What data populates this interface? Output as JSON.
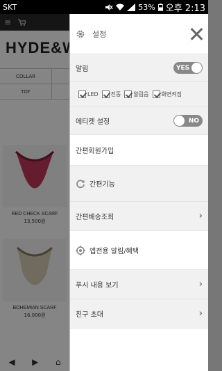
{
  "status_bar": {
    "carrier": "SKT",
    "battery": "53%",
    "time": "오후 2:13"
  },
  "background": {
    "logo": "HYDE&W",
    "categories": [
      [
        "COLLAR",
        ""
      ],
      [
        "TOY",
        ""
      ]
    ],
    "products": [
      {
        "name": "RED CHECK SCARF",
        "price": "13,500원"
      },
      {
        "name": "BOHEMIAN SCARF",
        "price": "16,000원"
      }
    ]
  },
  "drawer": {
    "title": "설정",
    "notifications": {
      "label": "알림",
      "toggle": "YES"
    },
    "checks": [
      {
        "label": "LED"
      },
      {
        "label": "진동"
      },
      {
        "label": "알림음"
      },
      {
        "label": "화면켜짐"
      }
    ],
    "etiquette": {
      "label": "에티켓 설정",
      "toggle": "NO"
    },
    "simple_join": "간편회원가입",
    "simple_func": "간편기능",
    "simple_delivery": "간편배송조회",
    "app_benefits": "앱전용 알림/혜택",
    "push_view": "푸시 내용 보기",
    "invite": "친구 초대"
  },
  "colors": {
    "toggle": "#888888",
    "row_gray": "#f1f1f1"
  }
}
